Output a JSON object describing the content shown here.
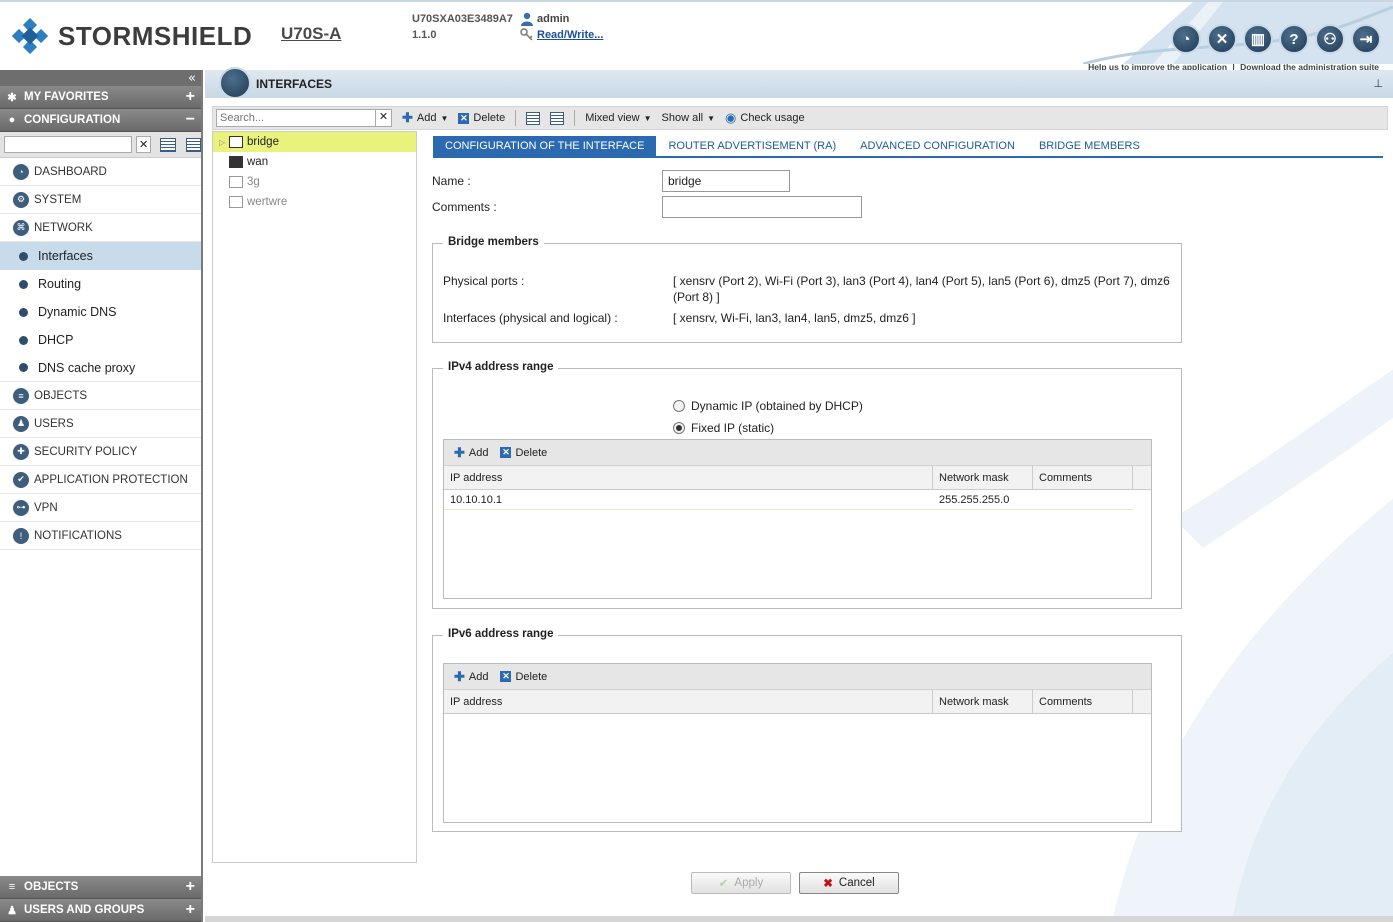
{
  "header": {
    "brand": "STORMSHIELD",
    "model": "U70S-A",
    "serial": "U70SXA03E3489A7",
    "version": "1.1.0",
    "user": "admin",
    "access": "Read/Write...",
    "help_link": "Help us to improve the application",
    "download_link": "Download the administration suite",
    "tool_icons": [
      "dashboard-gauge-icon",
      "tools-icon",
      "monitoring-icon",
      "help-icon",
      "support-icon",
      "logout-icon"
    ]
  },
  "sidebar": {
    "favorites": "MY FAVORITES",
    "configuration": "CONFIGURATION",
    "menu_top": [
      {
        "label": "DASHBOARD",
        "icon": "dashboard-icon"
      },
      {
        "label": "SYSTEM",
        "icon": "system-icon"
      },
      {
        "label": "NETWORK",
        "icon": "network-icon"
      }
    ],
    "network_sub": [
      {
        "label": "Interfaces"
      },
      {
        "label": "Routing"
      },
      {
        "label": "Dynamic DNS"
      },
      {
        "label": "DHCP"
      },
      {
        "label": "DNS cache proxy"
      }
    ],
    "menu_bottom": [
      {
        "label": "OBJECTS",
        "icon": "objects-icon"
      },
      {
        "label": "USERS",
        "icon": "users-icon"
      },
      {
        "label": "SECURITY POLICY",
        "icon": "security-policy-icon"
      },
      {
        "label": "APPLICATION PROTECTION",
        "icon": "app-protection-icon"
      },
      {
        "label": "VPN",
        "icon": "vpn-icon"
      },
      {
        "label": "NOTIFICATIONS",
        "icon": "notifications-icon"
      }
    ],
    "bottom_objects": "OBJECTS",
    "bottom_users": "USERS AND GROUPS"
  },
  "page": {
    "title": "INTERFACES"
  },
  "toolbar": {
    "search_placeholder": "Search...",
    "add": "Add",
    "delete": "Delete",
    "mixed_view": "Mixed view",
    "show_all": "Show all",
    "check_usage": "Check usage"
  },
  "tree": [
    {
      "label": "bridge"
    },
    {
      "label": "wan"
    },
    {
      "label": "3g"
    },
    {
      "label": "wertwre"
    }
  ],
  "tabs": [
    "CONFIGURATION OF THE INTERFACE",
    "ROUTER ADVERTISEMENT (RA)",
    "ADVANCED CONFIGURATION",
    "BRIDGE MEMBERS"
  ],
  "form": {
    "name_label": "Name :",
    "name_value": "bridge",
    "comments_label": "Comments :",
    "comments_value": ""
  },
  "bridge_members": {
    "legend": "Bridge members",
    "physical_label": "Physical ports :",
    "physical_value": "[ xensrv (Port 2), Wi-Fi (Port 3), lan3 (Port 4), lan4 (Port 5), lan5 (Port 6), dmz5 (Port 7), dmz6 (Port 8) ]",
    "interfaces_label": "Interfaces (physical and logical) :",
    "interfaces_value": "[ xensrv, Wi-Fi, lan3, lan4, lan5, dmz5, dmz6 ]"
  },
  "ipv4": {
    "legend": "IPv4 address range",
    "dynamic_label": "Dynamic IP (obtained by DHCP)",
    "fixed_label": "Fixed IP (static)",
    "selected": "fixed",
    "add": "Add",
    "delete": "Delete",
    "columns": [
      "IP address",
      "Network mask",
      "Comments"
    ],
    "rows": [
      {
        "ip": "10.10.10.1",
        "mask": "255.255.255.0",
        "comment": ""
      }
    ]
  },
  "ipv6": {
    "legend": "IPv6 address range",
    "add": "Add",
    "delete": "Delete",
    "columns": [
      "IP address",
      "Network mask",
      "Comments"
    ]
  },
  "footer": {
    "apply": "Apply",
    "cancel": "Cancel"
  }
}
